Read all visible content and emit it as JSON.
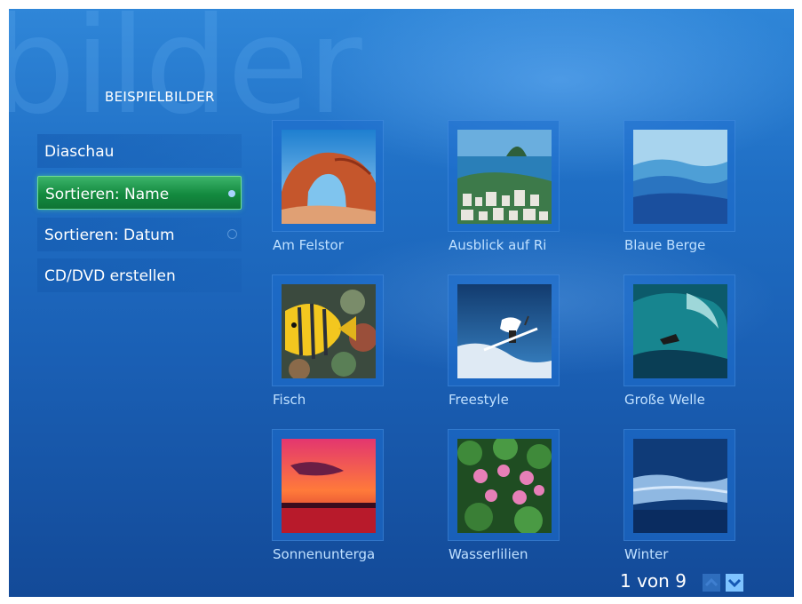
{
  "watermark": "bilder",
  "title": "BEISPIELBILDER",
  "menu": [
    {
      "label": "Diaschau"
    },
    {
      "label": "Sortieren: Name"
    },
    {
      "label": "Sortieren: Datum"
    },
    {
      "label": "CD/DVD erstellen"
    }
  ],
  "pictures": [
    {
      "caption": "Am Felstor"
    },
    {
      "caption": "Ausblick auf Ri"
    },
    {
      "caption": "Blaue Berge"
    },
    {
      "caption": "Fisch"
    },
    {
      "caption": "Freestyle"
    },
    {
      "caption": "Große Welle"
    },
    {
      "caption": "Sonnenunterga"
    },
    {
      "caption": "Wasserlilien"
    },
    {
      "caption": "Winter"
    }
  ],
  "pager": {
    "text": "1 von 9"
  },
  "colors": {
    "active_item": "#1f9a4f",
    "background": "#1a5fb4",
    "caption": "#bfe0ff"
  }
}
